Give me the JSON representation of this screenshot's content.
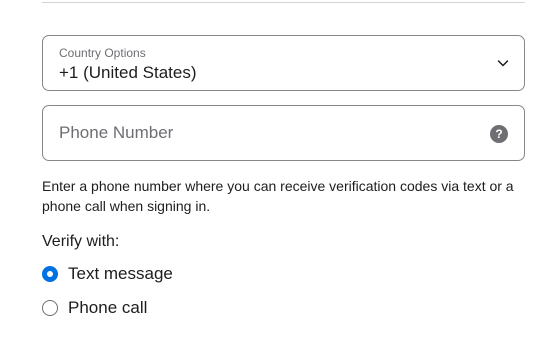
{
  "country": {
    "label": "Country Options",
    "value": "+1 (United States)"
  },
  "phone": {
    "placeholder": "Phone Number",
    "value": "",
    "help_icon": "?"
  },
  "helper_text": "Enter a phone number where you can receive verification codes via text or a phone call when signing in.",
  "verify": {
    "label": "Verify with:",
    "options": [
      {
        "label": "Text message",
        "selected": true
      },
      {
        "label": "Phone call",
        "selected": false
      }
    ]
  },
  "colors": {
    "accent": "#0071e3",
    "border": "#86868b",
    "text": "#1d1d1f",
    "secondary_text": "#6e6e73"
  },
  "icons": {
    "country_dropdown": "chevron-down-icon",
    "phone_help": "help-icon"
  }
}
